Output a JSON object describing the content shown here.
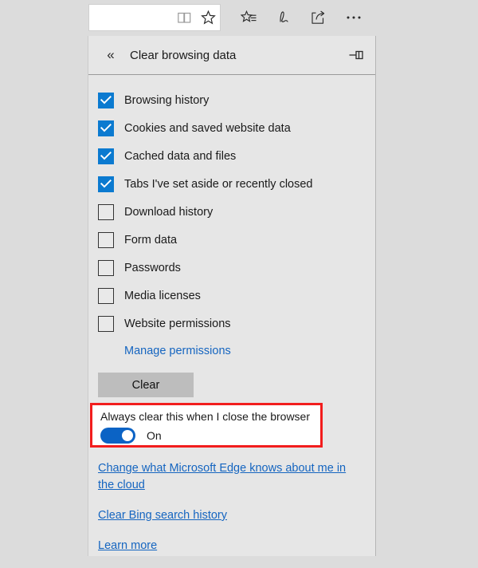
{
  "browser": {
    "address_bar": {
      "value": "",
      "placeholder": "",
      "icons": [
        {
          "name": "reading-view-icon",
          "label": "Reading view"
        },
        {
          "name": "favorites-star-icon",
          "label": "Add to favorites or reading list"
        }
      ]
    },
    "toolbar_icons": [
      {
        "name": "hub-icon",
        "label": "Hub (favorites, reading list, history, downloads)"
      },
      {
        "name": "web-note-icon",
        "label": "Make a Web Note"
      },
      {
        "name": "share-icon",
        "label": "Share"
      },
      {
        "name": "settings-more-icon",
        "label": "Settings and more"
      }
    ]
  },
  "panel": {
    "title": "Clear browsing data",
    "back_label": "«",
    "pin_label": "Pin",
    "options": [
      {
        "label": "Browsing history",
        "checked": true
      },
      {
        "label": "Cookies and saved website data",
        "checked": true
      },
      {
        "label": "Cached data and files",
        "checked": true
      },
      {
        "label": "Tabs I've set aside or recently closed",
        "checked": true
      },
      {
        "label": "Download history",
        "checked": false
      },
      {
        "label": "Form data",
        "checked": false
      },
      {
        "label": "Passwords",
        "checked": false
      },
      {
        "label": "Media licenses",
        "checked": false
      },
      {
        "label": "Website permissions",
        "checked": false
      }
    ],
    "manage_permissions_label": "Manage permissions",
    "clear_button_label": "Clear",
    "always_clear": {
      "label": "Always clear this when I close the browser",
      "state": "On",
      "highlight_color": "#f21d1d",
      "toggle_color": "#0b63c5"
    },
    "footer_links": [
      "Change what Microsoft Edge knows about me in the cloud",
      "Clear Bing search history",
      "Learn more"
    ]
  },
  "colors": {
    "panel_background": "#e6e6e6",
    "page_background": "#dcdcdc",
    "accent": "#0b7ad0",
    "link": "#1565c0",
    "button": "#bdbdbd"
  }
}
